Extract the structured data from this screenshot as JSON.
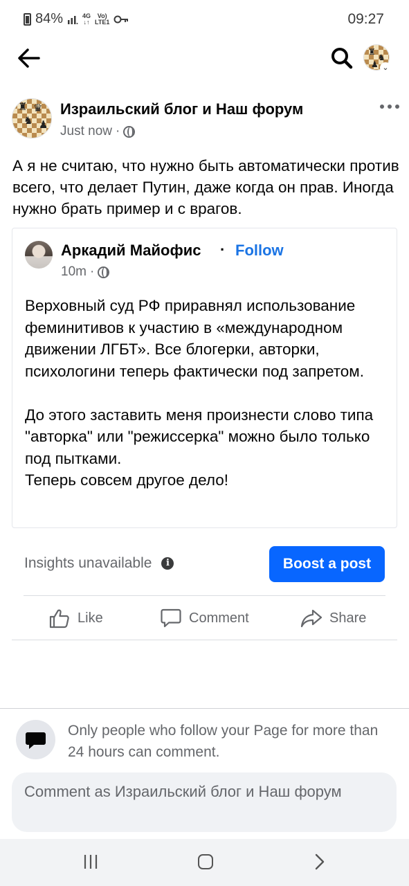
{
  "status_bar": {
    "battery": "84%",
    "network_top": "4G",
    "network_volte": "Vo)",
    "network_bottom": "LTE1",
    "time": "09:27"
  },
  "nav": {
    "back_icon": "arrow-left-icon",
    "search_icon": "search-icon",
    "profile_icon": "profile-avatar-chessboard"
  },
  "post": {
    "author": "Израильский блог и Наш форум",
    "time": "Just now",
    "separator": "·",
    "privacy_icon": "globe-icon",
    "text": "А я не считаю, что нужно быть автоматически против всего, что делает Путин, даже когда он прав. Иногда нужно брать пример и с врагов."
  },
  "shared": {
    "author": "Аркадий Майофис",
    "separator": "·",
    "follow_label": "Follow",
    "time": "10m",
    "paragraphs": [
      "Верховный суд РФ приравнял использование феминитивов к участию в «международном движении ЛГБТ». Все блогерки, авторки, психологини теперь фактически под запретом.",
      "До этого заставить меня произнести слово типа \"авторка\" или \"режиссерка\" можно было только под пытками.\nТеперь совсем другое дело!"
    ]
  },
  "insights": {
    "label": "Insights unavailable",
    "info_glyph": "i",
    "boost_label": "Boost a post"
  },
  "actions": {
    "like": "Like",
    "comment": "Comment",
    "share": "Share"
  },
  "comments": {
    "notice": "Only people who follow your Page for more than 24 hours can comment.",
    "placeholder": "Comment as Израильский блог и Наш форум"
  },
  "colors": {
    "accent": "#0866ff",
    "link": "#1b74e4",
    "secondary_text": "#65676b"
  }
}
